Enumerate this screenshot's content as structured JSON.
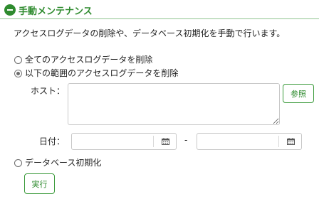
{
  "header": {
    "title": "手動メンテナンス",
    "icon": "minus-circle-icon",
    "accent_color": "#2e8b2e"
  },
  "description": "アクセスログデータの削除や、データベース初期化を手動で行います。",
  "options": {
    "delete_all_label": "全てのアクセスログデータを削除",
    "delete_range_label": "以下の範囲のアクセスログデータを削除",
    "init_db_label": "データベース初期化",
    "selected": "delete_range"
  },
  "host": {
    "label": "ホスト：",
    "value": "",
    "browse_label": "参照"
  },
  "date": {
    "label": "日付：",
    "from_value": "",
    "to_value": "",
    "separator": "-",
    "icon": "calendar-icon"
  },
  "execute_label": "実行"
}
